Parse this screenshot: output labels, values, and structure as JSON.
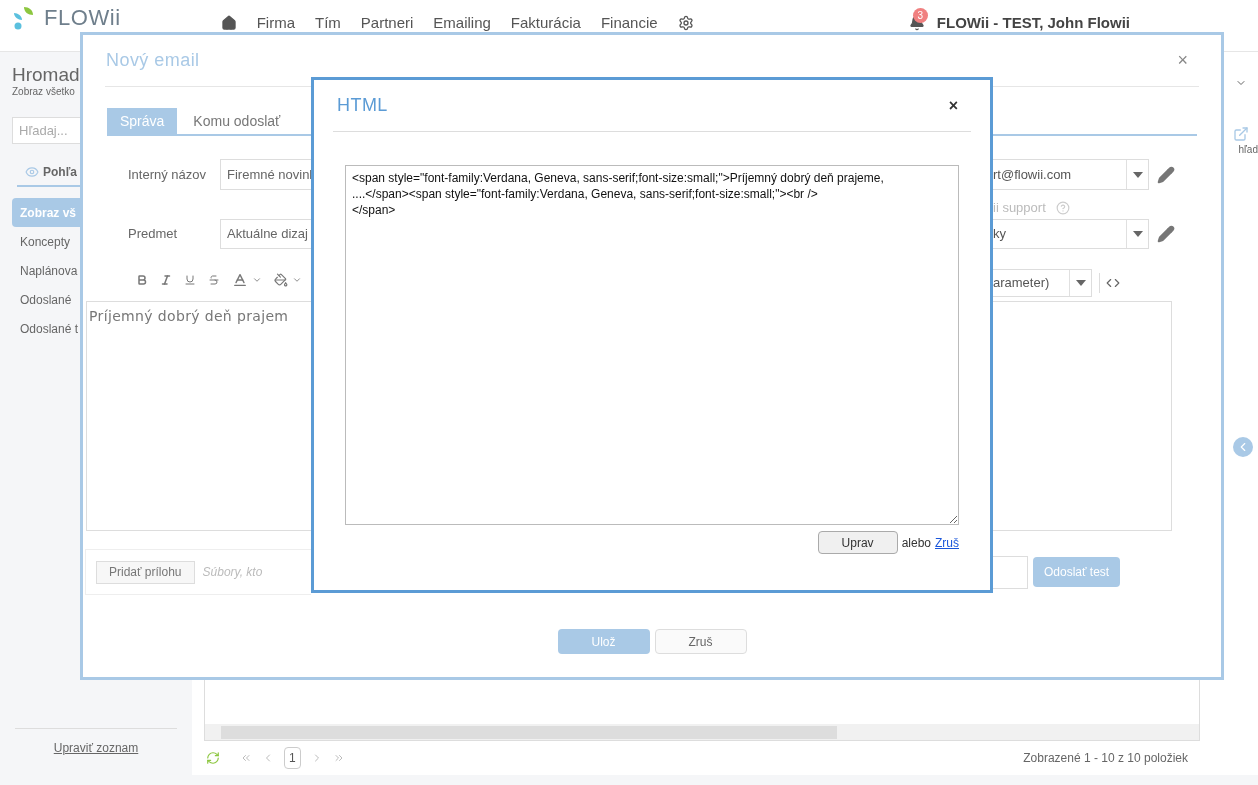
{
  "app": {
    "logo": "FLOWii",
    "nav": [
      {
        "label": "Firma"
      },
      {
        "label": "Tím"
      },
      {
        "label": "Partneri"
      },
      {
        "label": "Emailing"
      },
      {
        "label": "Fakturácia"
      },
      {
        "label": "Financie"
      }
    ],
    "notifications": "3",
    "user": "FLOWii - TEST, John Flowii"
  },
  "sidebar": {
    "title": "Hromad",
    "subtitle": "Zobraz všetko",
    "search": {
      "placeholder": "Hľadaj..."
    },
    "view_tab": "Pohľa",
    "items": [
      {
        "label": "Zobraz vš",
        "selected": true
      },
      {
        "label": "Koncepty",
        "selected": false
      },
      {
        "label": "Naplánova",
        "selected": false
      },
      {
        "label": "Odoslané",
        "selected": false
      },
      {
        "label": "Odoslané t",
        "selected": false
      }
    ],
    "footer_link": "Upraviť zoznam"
  },
  "right_strip": {
    "preview_label": "hľad"
  },
  "grid": {
    "page": "1",
    "summary": "Zobrazené 1 - 10 z 10 položiek"
  },
  "email_dialog": {
    "title": "Nový email",
    "close": "×",
    "tabs": [
      {
        "label": "Správa",
        "selected": true
      },
      {
        "label": "Komu odoslať",
        "selected": false
      }
    ],
    "internal_name": {
      "label": "Interný názov",
      "value": "Firemné novinl"
    },
    "sender": {
      "value": "rt@flowii.com"
    },
    "sender_name": "ii support",
    "subject": {
      "label": "Predmet",
      "value": "Aktuálne dizaj"
    },
    "template": {
      "value": "ky"
    },
    "parameter_select": {
      "value": "arameter)"
    },
    "editor_text": "Príjemný dobrý deň prajem",
    "attach_button": "Pridať prílohu",
    "attach_hint": "Súbory, kto",
    "send_test": "Odoslať test",
    "save": "Ulož",
    "cancel": "Zruš"
  },
  "html_dialog": {
    "title": "HTML",
    "close": "×",
    "source": "<span style=\"font-family:Verdana, Geneva, sans-serif;font-size:small;\">Príjemný dobrý deň prajeme,\n....</span><span style=\"font-family:Verdana, Geneva, sans-serif;font-size:small;\"><br />\n</span>",
    "apply": "Uprav",
    "or": "alebo",
    "cancel": "Zruš"
  }
}
